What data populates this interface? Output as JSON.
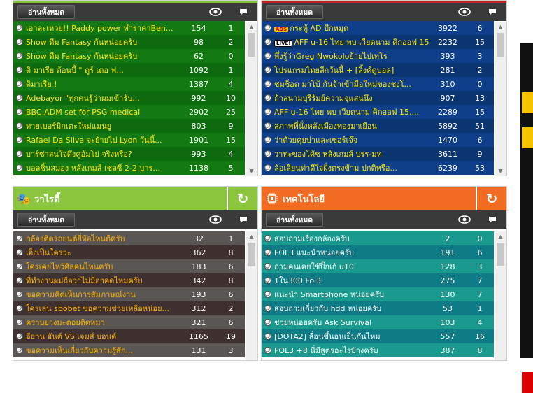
{
  "colors": {
    "green": "#137a13",
    "green_alt": "#0e6a0e",
    "blue": "#0f3f8a",
    "blue_alt": "#0a3570",
    "gray": "#5a5654",
    "gray_alt": "#3e3130",
    "teal": "#1a9a8e",
    "teal_alt": "#0e7c86",
    "variety_head": "#8cc63f",
    "tech_head": "#f26b22"
  },
  "read_all_label": "อ่านทั้งหมด",
  "panels": {
    "football_thai": {
      "rows": [
        {
          "title": "เอาละเหวย!! Paddy power ทำราคาBen...",
          "views": "154",
          "comments": "1"
        },
        {
          "title": "Show ทีม Fantasy กันหน่อยครับ",
          "views": "98",
          "comments": "2"
        },
        {
          "title": "Show ทีม Fantasy กันหน่อยครับ",
          "views": "62",
          "comments": "0"
        },
        {
          "title": "ดิ มาเรีย ต้อนบี้ \" ตูร์ เดอ ฟ...",
          "views": "1092",
          "comments": "1"
        },
        {
          "title": "ดิมาเรีย !",
          "views": "1387",
          "comments": "4"
        },
        {
          "title": "Adebayor \"ทุกคนรู้ว่าผมเข้ารับ...",
          "views": "992",
          "comments": "10"
        },
        {
          "title": "BBC:ADM set for PSG medical",
          "views": "2902",
          "comments": "25"
        },
        {
          "title": "ทายเบอร์มิกเตะใหม่แมนยู",
          "views": "803",
          "comments": "9"
        },
        {
          "title": "Rafael Da Silva จะย้ายไป Lyon วันนี้...",
          "views": "1901",
          "comments": "15"
        },
        {
          "title": "บาร์ซ่าสนใจดึงคูอัมโย่ จริงหรือ?",
          "views": "993",
          "comments": "4"
        },
        {
          "title": "บอลชิ้นสมอง หลังเกมส์ เชลซี 2-2 บาร...",
          "views": "1138",
          "comments": "5"
        }
      ]
    },
    "football_world": {
      "rows": [
        {
          "tag": "ADS",
          "title": "กระทู้ AD ปักหมุด",
          "views": "3922",
          "comments": "6"
        },
        {
          "tag": "LIVE!",
          "title": "AFF u-16 ไทย พบ เวียดนาม คิกออฟ 15....",
          "views": "2232",
          "comments": "15"
        },
        {
          "title": "พึ่งรู้ว่าGreg Nwokoloย้ายไปเทโร",
          "views": "393",
          "comments": "3"
        },
        {
          "title": "โปรแกรมไทยลีกวันนี้ + [ลิ้งค์ดูบอล]",
          "views": "281",
          "comments": "2"
        },
        {
          "title": "ชมช็อต มาโบ้ กันจ้าเข้ามือใหม่ของชงโ...",
          "views": "310",
          "comments": "0"
        },
        {
          "title": "ถ้าสนามบุรีรัมย์ความจุแสนนึง",
          "views": "907",
          "comments": "13"
        },
        {
          "title": "AFF u-16 ไทย พบ เวียดนาม คิกออฟ 15....",
          "views": "2289",
          "comments": "15"
        },
        {
          "title": "สภาพที่นั่งหลังเมืองทองมาเยือน",
          "views": "5892",
          "comments": "51"
        },
        {
          "title": "ว่าด้วยคุยบ่าและเซอร์เจ๊จ",
          "views": "1470",
          "comments": "6"
        },
        {
          "title": "วาทะของโค้ช หลังเกมส์ บรร-มท",
          "views": "3611",
          "comments": "9"
        },
        {
          "title": "ล้อเลียนท่าดีใจฝั่งตรงข้าม ปกติหรือ...",
          "views": "6239",
          "comments": "53"
        }
      ]
    },
    "variety": {
      "title": "วาไรตี้",
      "rows": [
        {
          "title": "กล้องติดรถยนต์ยี่ห้อไหนดีครับ",
          "views": "32",
          "comments": "1"
        },
        {
          "title": "เอ็งเป็นใครวะ",
          "views": "362",
          "comments": "8"
        },
        {
          "title": "ใครเคยไหว้ศิลคนไหนครับ",
          "views": "183",
          "comments": "6"
        },
        {
          "title": "ที่ทำงานผมถือว่าไม่มีอาคดไหมครับ",
          "views": "342",
          "comments": "8"
        },
        {
          "title": "ขอความคิดเห็นการสัมภาษณ์งาน",
          "views": "193",
          "comments": "6"
        },
        {
          "title": "ใครเล่น sbobet ขอความช่วยเหลือหน่อย...",
          "views": "312",
          "comments": "2"
        },
        {
          "title": "คราบยางมะตอยติดหมา",
          "views": "321",
          "comments": "6"
        },
        {
          "title": "อีธาน ฮันต์ VS เจมส์ บอนด์",
          "views": "1165",
          "comments": "19"
        },
        {
          "title": "ขอความเห็นเกี่ยวกับความรู้สึก...",
          "views": "131",
          "comments": "3"
        }
      ]
    },
    "tech": {
      "title": "เทคโนโลยี",
      "rows": [
        {
          "title": "สอบถามเรื่องกล้องครับ",
          "views": "2",
          "comments": "0"
        },
        {
          "title": "FOL3 แนะนำหน่อยครับ",
          "views": "191",
          "comments": "6"
        },
        {
          "title": "ถามคนเคยใช้ปิ๊กเก้ u10",
          "views": "128",
          "comments": "3"
        },
        {
          "title": "1ใน300 Fol3",
          "views": "275",
          "comments": "7"
        },
        {
          "title": "แนะนำ Smartphone หน่อยครับ",
          "views": "130",
          "comments": "7"
        },
        {
          "title": "สอบถามเกี่ยวกับ hdd หน่อยครับ",
          "views": "53",
          "comments": "1"
        },
        {
          "title": "ช่วยหน่อยครับ Ask Survival",
          "views": "103",
          "comments": "4"
        },
        {
          "title": "[DOTA2] ลื่อนขึ้นอนเย็นกันไหม",
          "views": "557",
          "comments": "16"
        },
        {
          "title": "FOL3 +8 นี่มีสูตรอะไรบ้างครับ",
          "views": "387",
          "comments": "8"
        }
      ]
    }
  }
}
